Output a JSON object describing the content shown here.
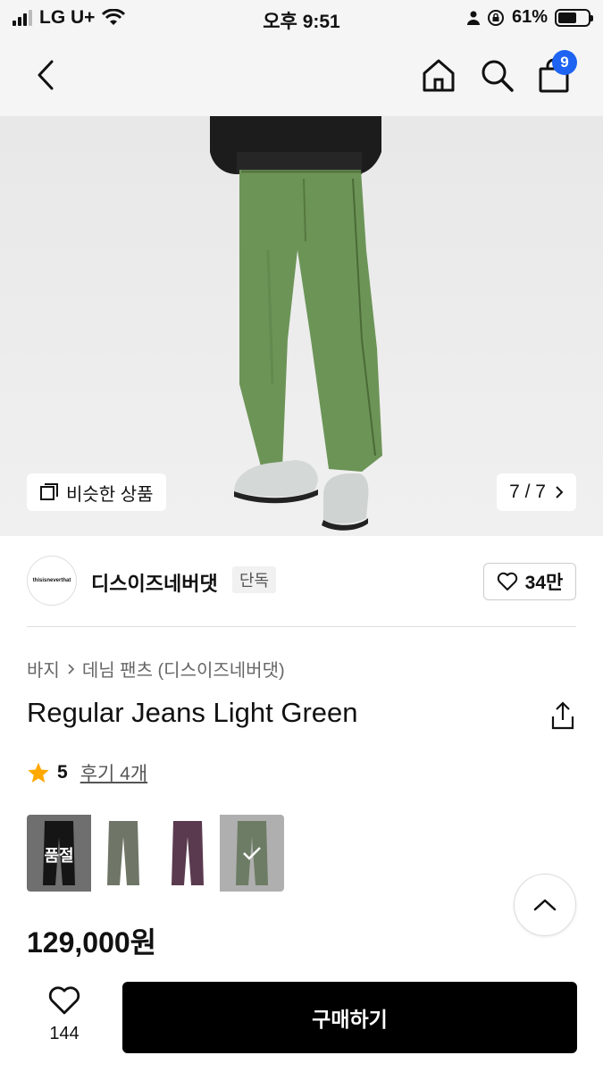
{
  "status_bar": {
    "carrier": "LG U+",
    "time": "오후 9:51",
    "battery": "61%",
    "battery_level": 0.61
  },
  "nav": {
    "back_icon": "chevron-left-icon",
    "home_icon": "home-icon",
    "search_icon": "search-icon",
    "cart_icon": "shopping-bag-icon",
    "cart_badge": "9",
    "badge_color": "#1e63f2"
  },
  "hero": {
    "similar_label": "비슷한 상품",
    "image_counter": "7 / 7"
  },
  "brand": {
    "logo_text": "thisisneverthat",
    "name": "디스이즈네버댓",
    "tag": "단독",
    "likes": "34만"
  },
  "product": {
    "breadcrumb": [
      "바지",
      "데님 팬츠 (디스이즈네버댓)"
    ],
    "title": "Regular Jeans Light Green",
    "rating": "5",
    "reviews_label": "후기 4개",
    "price": "129,000원"
  },
  "swatches": [
    {
      "name": "black",
      "color": "#1b1b1b",
      "sold_out": true,
      "label": "품절"
    },
    {
      "name": "grey-green",
      "color": "#6f7667",
      "sold_out": false,
      "label": ""
    },
    {
      "name": "purple",
      "color": "#5a3a4e",
      "sold_out": false,
      "label": ""
    },
    {
      "name": "light-green",
      "color": "#6d8f5a",
      "sold_out": false,
      "selected": true,
      "label": ""
    }
  ],
  "bottom": {
    "wish_count": "144",
    "buy_label": "구매하기"
  }
}
